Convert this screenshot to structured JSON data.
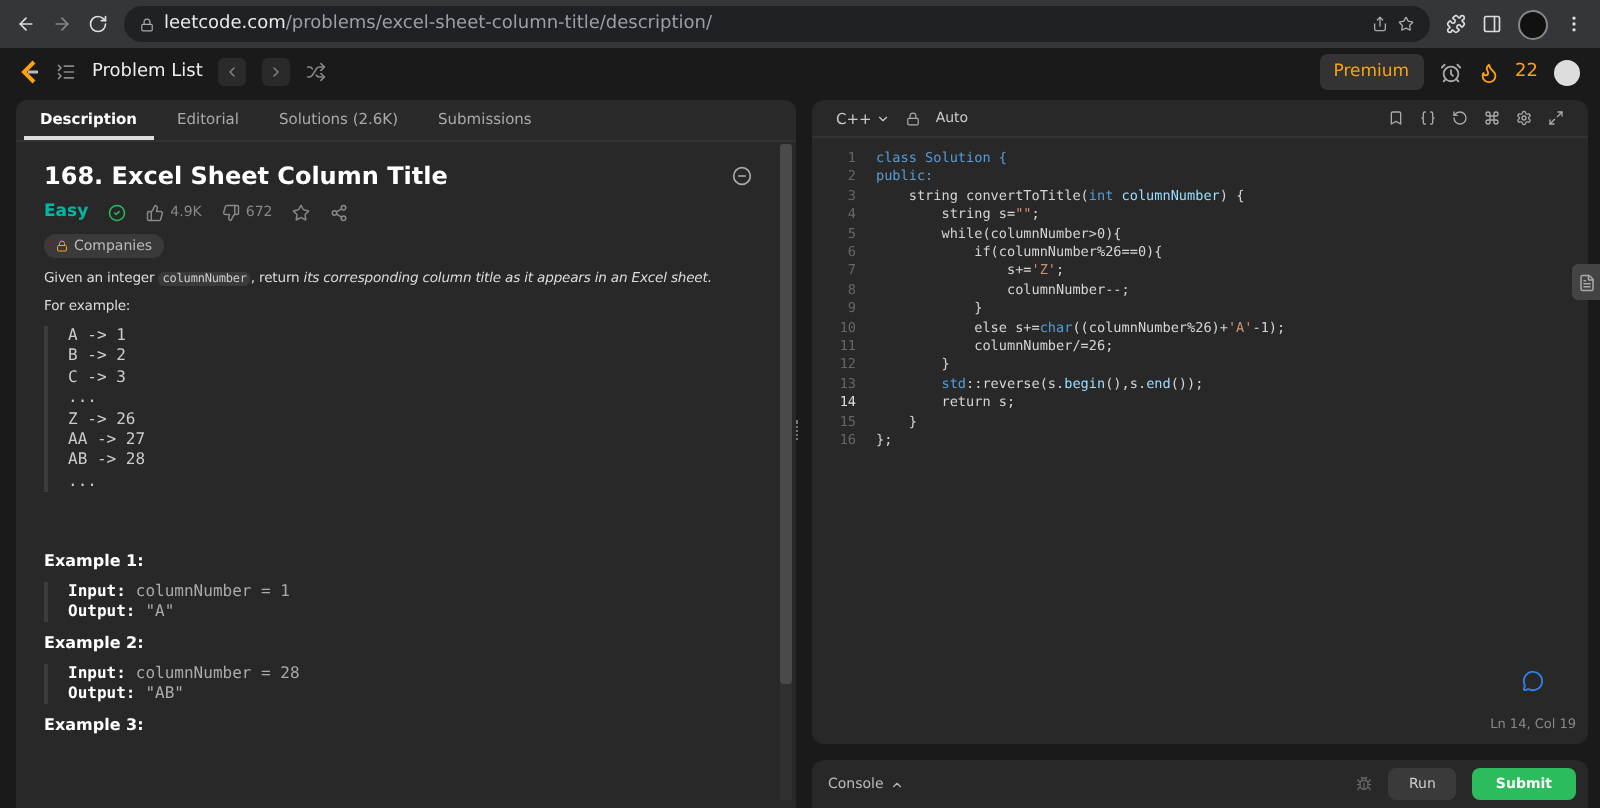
{
  "browser": {
    "url_host": "leetcode.com",
    "url_path": "/problems/excel-sheet-column-title/description/"
  },
  "header": {
    "problem_list": "Problem List",
    "premium": "Premium",
    "streak": "22"
  },
  "tabs": [
    {
      "label": "Description",
      "selected": true
    },
    {
      "label": "Editorial",
      "selected": false
    },
    {
      "label": "Solutions (2.6K)",
      "selected": false
    },
    {
      "label": "Submissions",
      "selected": false
    }
  ],
  "problem": {
    "title": "168. Excel Sheet Column Title",
    "difficulty": "Easy",
    "solved": true,
    "likes": "4.9K",
    "dislikes": "672",
    "companies": "Companies",
    "intro_before": "Given an integer ",
    "intro_code": "columnNumber",
    "intro_after": ", return *its corresponding column title as it appears in an Excel sheet.*",
    "for_example": "For example:",
    "mapping": [
      "A -> 1",
      "B -> 2",
      "C -> 3",
      "...",
      "Z -> 26",
      "AA -> 27",
      "AB -> 28",
      "..."
    ],
    "examples": [
      {
        "title": "Example 1:",
        "input_label": "Input:",
        "input": "columnNumber = 1",
        "output_label": "Output:",
        "output": "\"A\""
      },
      {
        "title": "Example 2:",
        "input_label": "Input:",
        "input": "columnNumber = 28",
        "output_label": "Output:",
        "output": "\"AB\""
      },
      {
        "title": "Example 3:"
      }
    ]
  },
  "editor": {
    "language": "C++",
    "mode": "Auto",
    "cursor": "Ln 14, Col 19",
    "lines": [
      {
        "no": "1",
        "current": false,
        "tokens": [
          {
            "kind": "kw",
            "text": "class Solution {"
          }
        ]
      },
      {
        "no": "2",
        "current": false,
        "tokens": [
          {
            "kind": "kw",
            "text": "public:"
          }
        ]
      },
      {
        "no": "3",
        "current": false,
        "tokens": [
          {
            "kind": "plain",
            "text": "    string convertToTitle("
          },
          {
            "kind": "kw",
            "text": "int"
          },
          {
            "kind": "id",
            "text": " columnNumber"
          },
          {
            "kind": "plain",
            "text": ") {"
          }
        ]
      },
      {
        "no": "4",
        "current": false,
        "tokens": [
          {
            "kind": "plain",
            "text": "        string s="
          },
          {
            "kind": "str",
            "text": "\"\""
          },
          {
            "kind": "plain",
            "text": ";"
          }
        ]
      },
      {
        "no": "5",
        "current": false,
        "tokens": [
          {
            "kind": "plain",
            "text": "        while(columnNumber>0){"
          }
        ]
      },
      {
        "no": "6",
        "current": false,
        "tokens": [
          {
            "kind": "plain",
            "text": "            if(columnNumber%26==0){"
          }
        ]
      },
      {
        "no": "7",
        "current": false,
        "tokens": [
          {
            "kind": "plain",
            "text": "                s+="
          },
          {
            "kind": "str",
            "text": "'Z'"
          },
          {
            "kind": "plain",
            "text": ";"
          }
        ]
      },
      {
        "no": "8",
        "current": false,
        "tokens": [
          {
            "kind": "plain",
            "text": "                columnNumber--;"
          }
        ]
      },
      {
        "no": "9",
        "current": false,
        "tokens": [
          {
            "kind": "plain",
            "text": "            }"
          }
        ]
      },
      {
        "no": "10",
        "current": false,
        "tokens": [
          {
            "kind": "plain",
            "text": "            else s+="
          },
          {
            "kind": "kw",
            "text": "char"
          },
          {
            "kind": "plain",
            "text": "((columnNumber%26)+"
          },
          {
            "kind": "str",
            "text": "'A'"
          },
          {
            "kind": "plain",
            "text": "-1);"
          }
        ]
      },
      {
        "no": "11",
        "current": false,
        "tokens": [
          {
            "kind": "plain",
            "text": "            columnNumber/=26;"
          }
        ]
      },
      {
        "no": "12",
        "current": false,
        "tokens": [
          {
            "kind": "plain",
            "text": "        }"
          }
        ]
      },
      {
        "no": "13",
        "current": false,
        "tokens": [
          {
            "kind": "kw",
            "text": "        std"
          },
          {
            "kind": "plain",
            "text": "::reverse(s."
          },
          {
            "kind": "id",
            "text": "begin"
          },
          {
            "kind": "plain",
            "text": "(),s."
          },
          {
            "kind": "id",
            "text": "end"
          },
          {
            "kind": "plain",
            "text": "());"
          }
        ]
      },
      {
        "no": "14",
        "current": true,
        "tokens": [
          {
            "kind": "plain",
            "text": "        return s;"
          }
        ]
      },
      {
        "no": "15",
        "current": false,
        "tokens": [
          {
            "kind": "plain",
            "text": "    }"
          }
        ]
      },
      {
        "no": "16",
        "current": false,
        "tokens": [
          {
            "kind": "plain",
            "text": "};"
          }
        ]
      }
    ]
  },
  "console": {
    "label": "Console",
    "run": "Run",
    "submit": "Submit"
  }
}
